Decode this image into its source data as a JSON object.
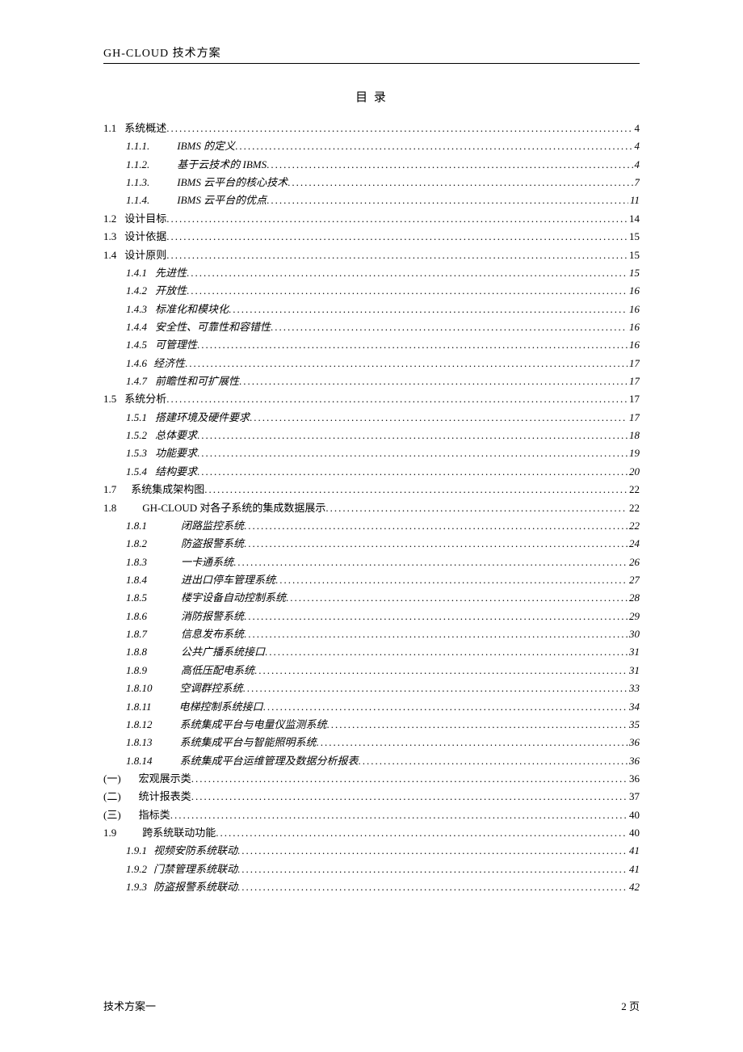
{
  "header": "GH-CLOUD 技术方案",
  "title": "目 录",
  "footer_left": "技术方案一",
  "footer_right": "2 页",
  "toc": [
    {
      "num": "1.1",
      "label": "系统概述",
      "page": "4",
      "indent": 0,
      "italic": false,
      "gap": 6
    },
    {
      "num": "1.1.1.",
      "label": "IBMS 的定义",
      "page": "4",
      "indent": 1,
      "italic": true,
      "gap": 30
    },
    {
      "num": "1.1.2.",
      "label": "基于云技术的 IBMS",
      "page": "4",
      "indent": 1,
      "italic": true,
      "gap": 30
    },
    {
      "num": "1.1.3.",
      "label": "IBMS 云平台的核心技术",
      "page": "7",
      "indent": 1,
      "italic": true,
      "gap": 30
    },
    {
      "num": "1.1.4.",
      "label": "IBMS 云平台的优点",
      "page": "11",
      "indent": 1,
      "italic": true,
      "gap": 30
    },
    {
      "num": "1.2",
      "label": "设计目标",
      "page": "14",
      "indent": 0,
      "italic": false,
      "gap": 6
    },
    {
      "num": "1.3",
      "label": "设计依据",
      "page": "15",
      "indent": 0,
      "italic": false,
      "gap": 6
    },
    {
      "num": "1.4",
      "label": "设计原则",
      "page": "15",
      "indent": 0,
      "italic": false,
      "gap": 6
    },
    {
      "num": "1.4.1",
      "label": "先进性",
      "page": "15",
      "indent": 1,
      "italic": true,
      "gap": 6
    },
    {
      "num": "1.4.2",
      "label": "开放性",
      "page": "16",
      "indent": 1,
      "italic": true,
      "gap": 6
    },
    {
      "num": "1.4.3",
      "label": "标准化和模块化",
      "page": "16",
      "indent": 1,
      "italic": true,
      "gap": 6
    },
    {
      "num": "1.4.4",
      "label": "安全性、可靠性和容错性",
      "page": "16",
      "indent": 1,
      "italic": true,
      "gap": 6
    },
    {
      "num": "1.4.5",
      "label": "可管理性",
      "page": "16",
      "indent": 1,
      "italic": true,
      "gap": 6
    },
    {
      "num": "1.4.6",
      "label": "经济性",
      "page": "17",
      "indent": 1,
      "italic": true,
      "gap": 4
    },
    {
      "num": "1.4.7",
      "label": "前瞻性和可扩展性",
      "page": "17",
      "indent": 1,
      "italic": true,
      "gap": 6
    },
    {
      "num": "1.5",
      "label": "系统分析",
      "page": "17",
      "indent": 0,
      "italic": false,
      "gap": 6
    },
    {
      "num": "1.5.1",
      "label": "搭建环境及硬件要求",
      "page": "17",
      "indent": 1,
      "italic": true,
      "gap": 6
    },
    {
      "num": "1.5.2",
      "label": "总体要求",
      "page": "18",
      "indent": 1,
      "italic": true,
      "gap": 6
    },
    {
      "num": "1.5.3",
      "label": "功能要求",
      "page": "19",
      "indent": 1,
      "italic": true,
      "gap": 6
    },
    {
      "num": "1.5.4",
      "label": "结构要求",
      "page": "20",
      "indent": 1,
      "italic": true,
      "gap": 6
    },
    {
      "num": "1.7",
      "label": "系统集成架构图",
      "page": "22",
      "indent": 0,
      "italic": false,
      "gap": 14
    },
    {
      "num": "1.8",
      "label": "GH-CLOUD 对各子系统的集成数据展示",
      "page": "22",
      "indent": 0,
      "italic": false,
      "gap": 28
    },
    {
      "num": "1.8.1",
      "label": "闭路监控系统",
      "page": "22",
      "indent": 1,
      "italic": true,
      "gap": 38
    },
    {
      "num": "1.8.2",
      "label": "防盗报警系统",
      "page": "24",
      "indent": 1,
      "italic": true,
      "gap": 38
    },
    {
      "num": "1.8.3",
      "label": "一卡通系统",
      "page": "26",
      "indent": 1,
      "italic": true,
      "gap": 38
    },
    {
      "num": "1.8.4",
      "label": "进出口停车管理系统",
      "page": "27",
      "indent": 1,
      "italic": true,
      "gap": 38
    },
    {
      "num": "1.8.5",
      "label": "楼宇设备自动控制系统",
      "page": "28",
      "indent": 1,
      "italic": true,
      "gap": 38
    },
    {
      "num": "1.8.6",
      "label": "消防报警系统",
      "page": "29",
      "indent": 1,
      "italic": true,
      "gap": 38
    },
    {
      "num": "1.8.7",
      "label": "信息发布系统",
      "page": "30",
      "indent": 1,
      "italic": true,
      "gap": 38
    },
    {
      "num": "1.8.8",
      "label": "公共广播系统接口",
      "page": "31",
      "indent": 1,
      "italic": true,
      "gap": 38
    },
    {
      "num": "1.8.9",
      "label": "高低压配电系统",
      "page": "31",
      "indent": 1,
      "italic": true,
      "gap": 38
    },
    {
      "num": "1.8.10",
      "label": "空调群控系统",
      "page": "33",
      "indent": 1,
      "italic": true,
      "gap": 30
    },
    {
      "num": "1.8.11",
      "label": "电梯控制系统接口",
      "page": "34",
      "indent": 1,
      "italic": true,
      "gap": 30
    },
    {
      "num": "1.8.12",
      "label": "系统集成平台与电量仪监测系统",
      "page": "35",
      "indent": 1,
      "italic": true,
      "gap": 30
    },
    {
      "num": "1.8.13",
      "label": "系统集成平台与智能照明系统",
      "page": "36",
      "indent": 1,
      "italic": true,
      "gap": 30
    },
    {
      "num": "1.8.14",
      "label": "系统集成平台运维管理及数据分析报表",
      "page": "36",
      "indent": 1,
      "italic": true,
      "gap": 30
    },
    {
      "num": "(一)",
      "label": "宏观展示类",
      "page": "36",
      "indent": 0,
      "italic": false,
      "gap": 18
    },
    {
      "num": "(二)",
      "label": "统计报表类",
      "page": "37",
      "indent": 0,
      "italic": false,
      "gap": 18
    },
    {
      "num": "(三)",
      "label": "指标类",
      "page": "40",
      "indent": 0,
      "italic": false,
      "gap": 18
    },
    {
      "num": "1.9",
      "label": "跨系统联动功能",
      "page": "40",
      "indent": 0,
      "italic": false,
      "gap": 28
    },
    {
      "num": "1.9.1",
      "label": "视频安防系统联动",
      "page": "41",
      "indent": 1,
      "italic": true,
      "gap": 4
    },
    {
      "num": "1.9.2",
      "label": "门禁管理系统联动",
      "page": "41",
      "indent": 1,
      "italic": true,
      "gap": 4
    },
    {
      "num": "1.9.3",
      "label": "防盗报警系统联动",
      "page": "42",
      "indent": 1,
      "italic": true,
      "gap": 4
    }
  ]
}
